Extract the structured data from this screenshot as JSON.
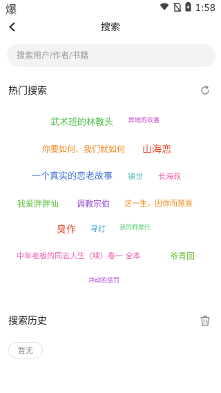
{
  "status_bar": {
    "left_glyph": "爆",
    "time": "1:58"
  },
  "header": {
    "title": "搜索"
  },
  "search": {
    "placeholder": "搜索用户/作者/书籍",
    "value": ""
  },
  "hot_search": {
    "title": "热门搜索",
    "tags": [
      {
        "text": "武术班的林教头",
        "color": "#4fc14a"
      },
      {
        "text": "异地的欢喜",
        "color": "#c33fcf"
      },
      {
        "text": "你要如何、我们就如何",
        "color": "#f08c1f"
      },
      {
        "text": "山海恋",
        "color": "#e24a2c"
      },
      {
        "text": "一个真实的恋老故事",
        "color": "#3d72d8"
      },
      {
        "text": "镇世",
        "color": "#52bfae"
      },
      {
        "text": "长海叔",
        "color": "#ee5aa8"
      },
      {
        "text": "我爱胖胖仙",
        "color": "#5fbf3f"
      },
      {
        "text": "调教宗伯",
        "color": "#9a48d8"
      },
      {
        "text": "这一生，因你而慧喜",
        "color": "#f28c17"
      },
      {
        "text": "臭作",
        "color": "#e24a2c"
      },
      {
        "text": "寻灯",
        "color": "#3d9ad8"
      },
      {
        "text": "我的野摩托",
        "color": "#5ccf77"
      },
      {
        "text": "中年老板的同志人生（续）卷一 全本",
        "color": "#ee5aa8"
      },
      {
        "text": "爷青回",
        "color": "#6abf3a"
      },
      {
        "text": "冲动的惩罚",
        "color": "#a34ed4"
      }
    ]
  },
  "history": {
    "title": "搜索历史",
    "empty_label": "暂无"
  },
  "colors": {
    "icon_gray": "#8f8f8f"
  }
}
